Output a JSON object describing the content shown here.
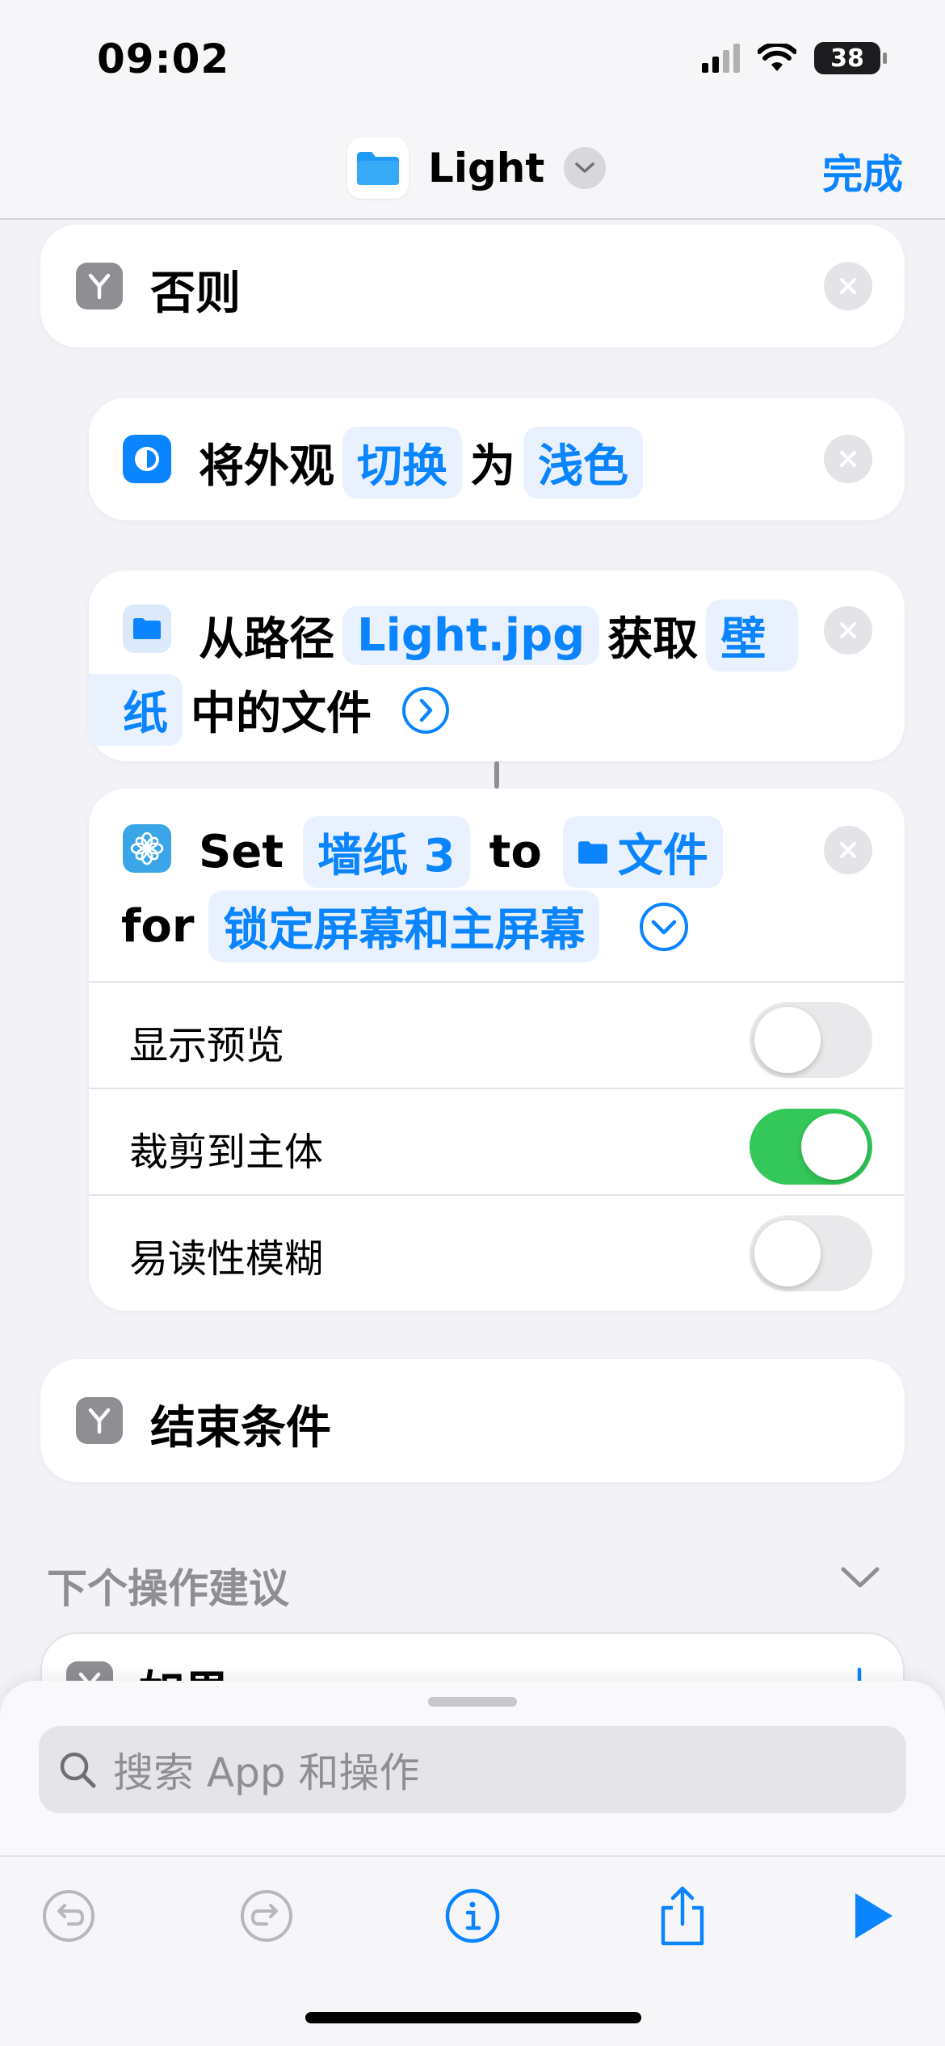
{
  "status": {
    "time": "09:02",
    "battery": "38"
  },
  "nav": {
    "title": "Light",
    "done_label": "完成"
  },
  "otherwise": {
    "label": "否则"
  },
  "appearance": {
    "prefix": "将外观",
    "action": "切换",
    "middle": "为",
    "value": "浅色"
  },
  "getfile": {
    "prefix": "从路径",
    "path": "Light.jpg",
    "middle": "获取",
    "folder_part1": "壁",
    "folder_part2": "纸",
    "suffix": "中的文件"
  },
  "setwallpaper": {
    "set": "Set",
    "wallpaper": "墙纸 3",
    "to": "to",
    "file": "文件",
    "for": "for",
    "target": "锁定屏幕和主屏幕",
    "options": [
      {
        "label": "显示预览",
        "on": false
      },
      {
        "label": "裁剪到主体",
        "on": true
      },
      {
        "label": "易读性模糊",
        "on": false
      }
    ]
  },
  "endif": {
    "label": "结束条件"
  },
  "suggestions": {
    "header": "下个操作建议",
    "first_item": "如果"
  },
  "search": {
    "placeholder": "搜索 App 和操作"
  },
  "colors": {
    "accent": "#0a84ff",
    "toggle_on": "#34c759",
    "background": "#f2f2f7"
  }
}
